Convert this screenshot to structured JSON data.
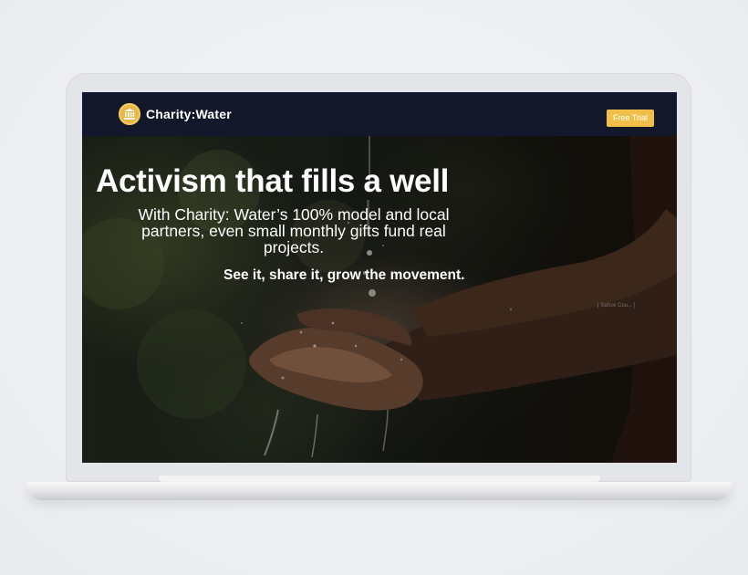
{
  "nav": {
    "brand": "Charity:Water",
    "cta_label": "Free Trial"
  },
  "hero": {
    "headline": "Activism that fills a well",
    "subhead": "With Charity: Water’s 100% model and local partners, even small monthly gifts fund real projects.",
    "tagline": "See it, share it, grow the movement.",
    "photo_credit": "[ Sahse Cou... ]"
  },
  "icons": {
    "logo": "bank-icon"
  },
  "colors": {
    "navbar": "#121829",
    "accent": "#f1bf48",
    "text": "#ffffff"
  }
}
